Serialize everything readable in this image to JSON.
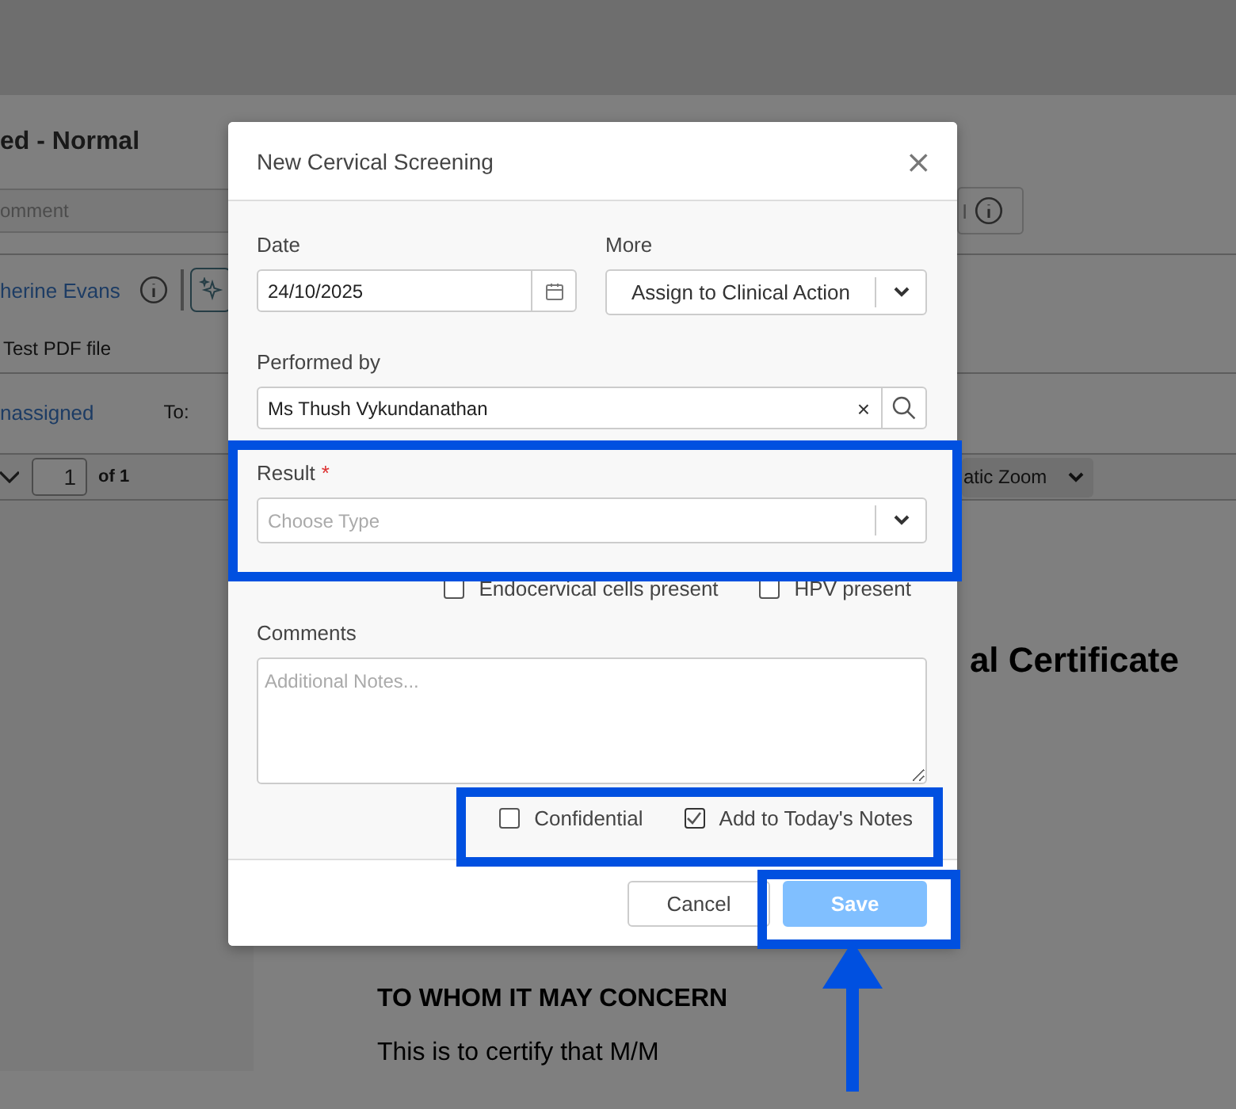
{
  "background": {
    "heading": "ed - Normal",
    "comment_placeholder": "omment",
    "right_field_text": "I",
    "author_link": "herine Evans",
    "file_name": "Test PDF file",
    "assignee_link": "nassigned",
    "to_label": "To:",
    "page_number": "1",
    "page_count": "of 1",
    "zoom_select": "atic Zoom",
    "document": {
      "title": "al Certificate",
      "salutation": "TO WHOM IT MAY CONCERN",
      "body": "This is to certify that M/M"
    }
  },
  "dialog": {
    "title": "New Cervical Screening",
    "close": "×",
    "date": {
      "label": "Date",
      "value": "24/10/2025"
    },
    "more": {
      "label": "More",
      "button": "Assign to Clinical Action"
    },
    "performed_by": {
      "label": "Performed by",
      "value": "Ms Thush Vykundanathan",
      "clear": "×"
    },
    "result": {
      "label": "Result",
      "required_mark": "*",
      "placeholder": "Choose Type"
    },
    "flags": [
      {
        "label": "Endocervical cells present",
        "checked": false
      },
      {
        "label": "HPV present",
        "checked": false
      }
    ],
    "comments": {
      "label": "Comments",
      "placeholder": "Additional Notes..."
    },
    "options": [
      {
        "label": "Confidential",
        "checked": false
      },
      {
        "label": "Add to Today's Notes",
        "checked": true
      }
    ],
    "buttons": [
      {
        "label": "Cancel",
        "kind": "secondary"
      },
      {
        "label": "Save",
        "kind": "primary",
        "disabled": true
      }
    ]
  }
}
